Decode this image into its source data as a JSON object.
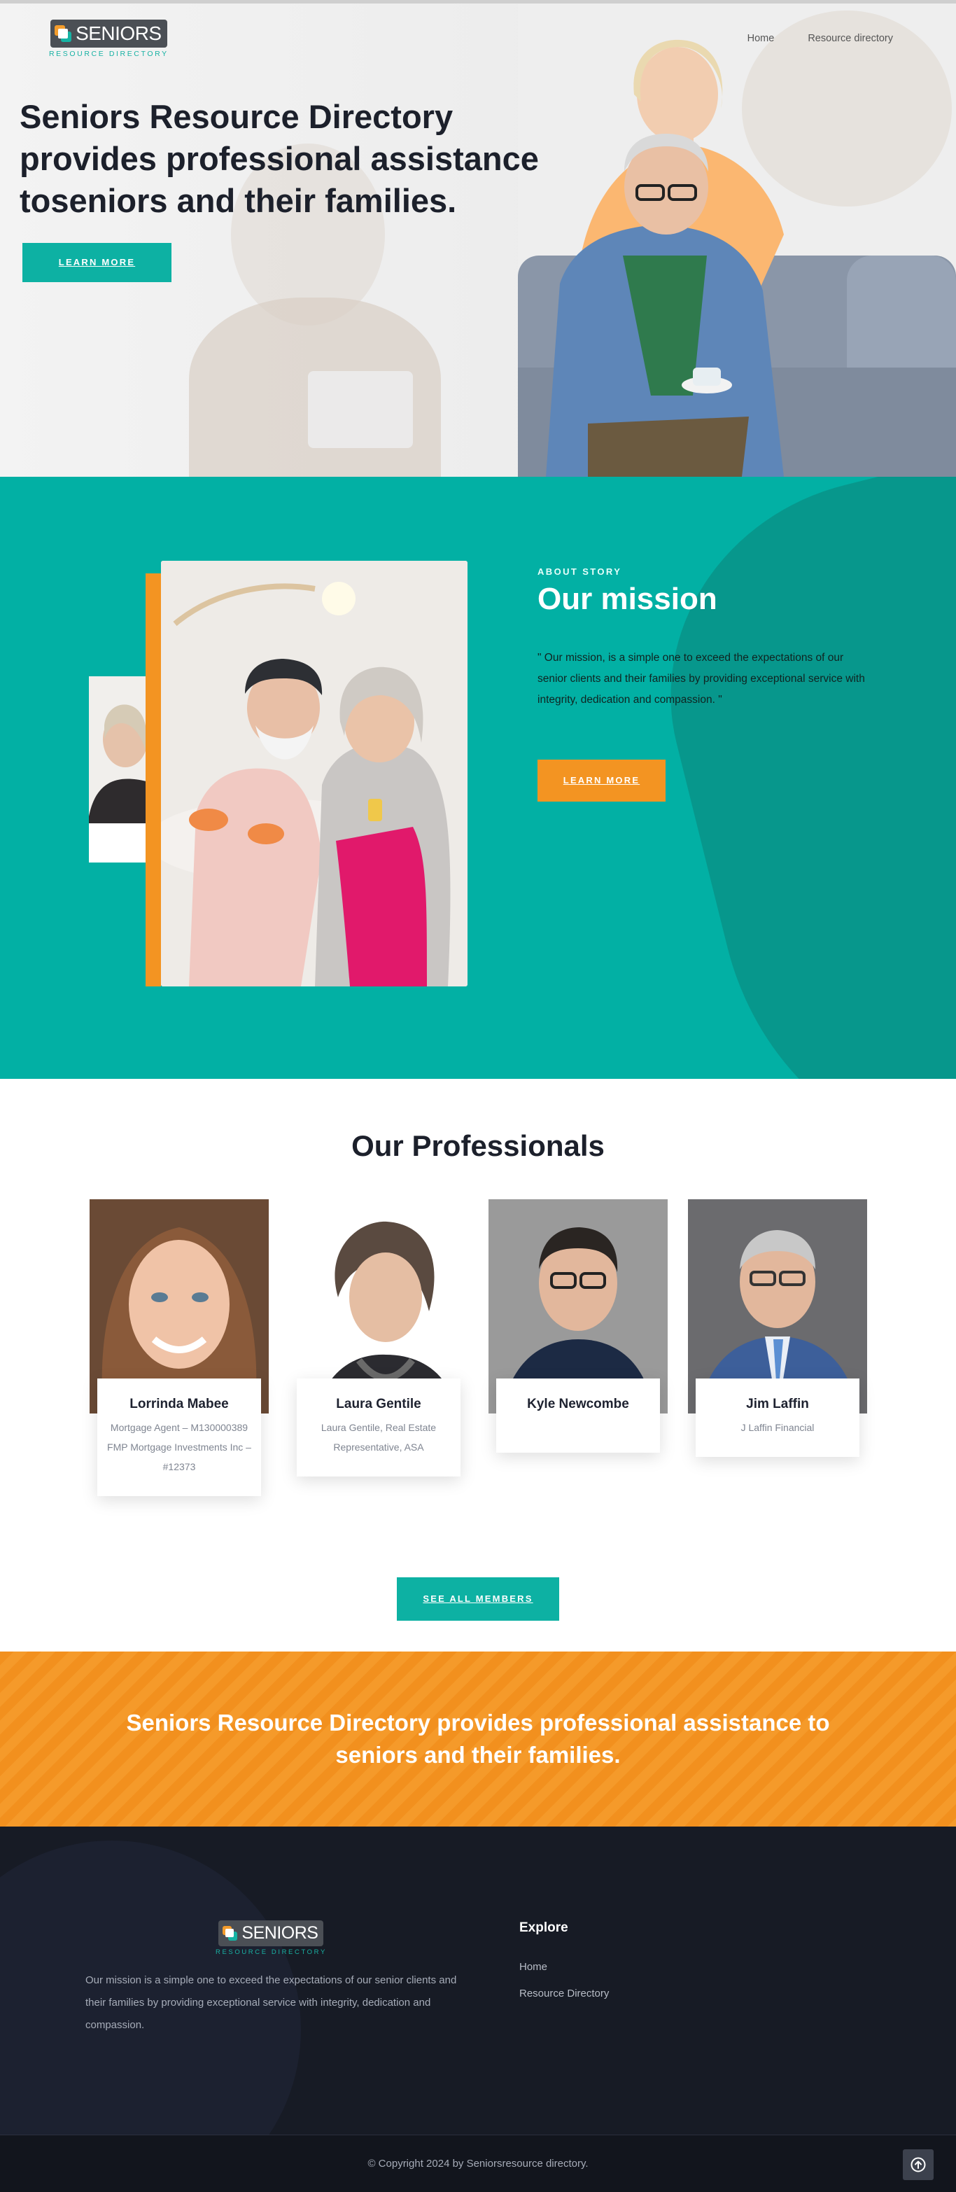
{
  "header": {
    "logo_word": "SENIORS",
    "logo_sub": "RESOURCE DIRECTORY",
    "nav": [
      {
        "label": "Home"
      },
      {
        "label": "Resource directory"
      }
    ]
  },
  "hero": {
    "title": "Seniors Resource Directory provides professional assistance toseniors and their families.",
    "cta_label": "LEARN MORE"
  },
  "mission": {
    "eyebrow": "ABOUT STORY",
    "title": "Our mission",
    "text": "\" Our mission, is a simple one to exceed the expectations of our senior clients and their families by providing exceptional service with integrity, dedication and compassion. \"",
    "cta_label": "LEARN MORE"
  },
  "professionals": {
    "title": "Our Professionals",
    "members": [
      {
        "name": "Lorrinda Mabee",
        "role": "Mortgage Agent – M130000389 FMP Mortgage Investments Inc – #12373"
      },
      {
        "name": "Laura Gentile",
        "role": "Laura Gentile, Real Estate Representative, ASA"
      },
      {
        "name": "Kyle Newcombe",
        "role": ""
      },
      {
        "name": "Jim Laffin",
        "role": "J Laffin Financial"
      }
    ],
    "cta_label": "SEE ALL MEMBERS"
  },
  "banner": {
    "text": "Seniors Resource Directory provides professional assistance to seniors and their families."
  },
  "footer": {
    "logo_word": "SENIORS",
    "logo_sub": "RESOURCE DIRECTORY",
    "about": "Our mission is a simple one to exceed the expectations of our senior clients and their families by providing exceptional service with integrity, dedication and compassion.",
    "explore_heading": "Explore",
    "links": [
      {
        "label": "Home"
      },
      {
        "label": "Resource Directory"
      }
    ],
    "copyright": "© Copyright 2024 by Seniorsresource directory.",
    "to_top_icon": "arrow-up-circle-icon"
  },
  "colors": {
    "teal": "#02b0a4",
    "teal_dark": "#07978c",
    "orange": "#f39422",
    "navy": "#171b25"
  }
}
